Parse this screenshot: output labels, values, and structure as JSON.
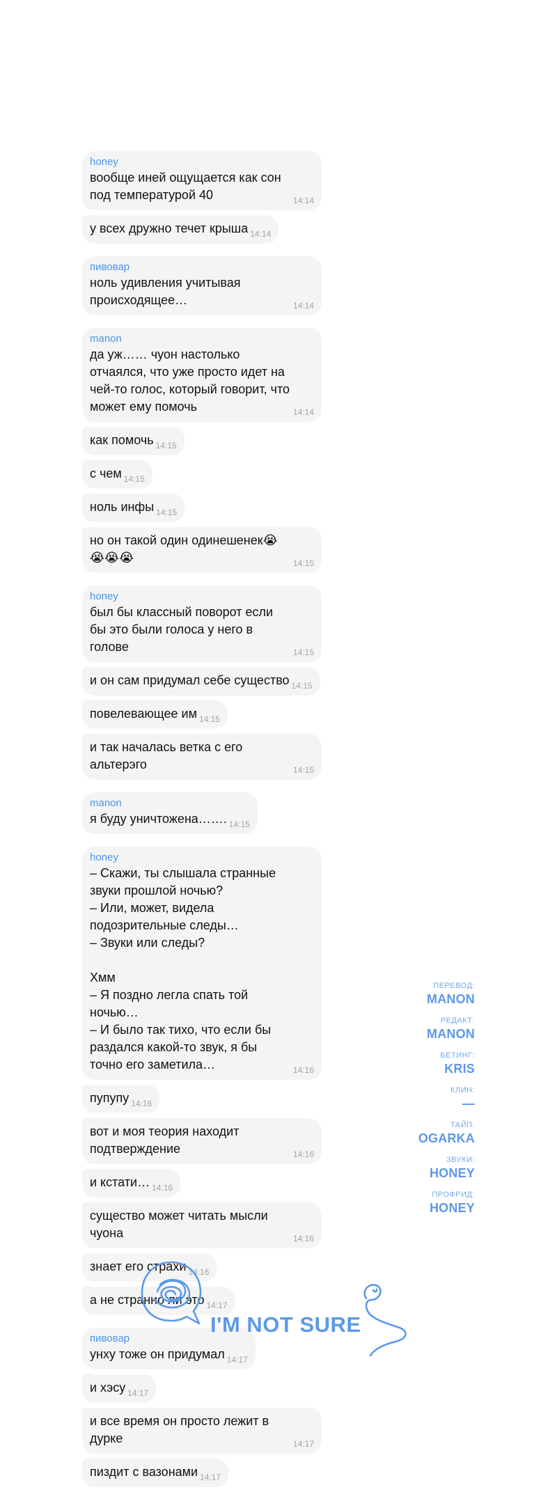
{
  "messages": [
    {
      "sender": "honey",
      "text": "вообще иней ощущается как сон под температурой 40",
      "time": "14:14"
    },
    {
      "text": "у всех дружно течет крыша",
      "time": "14:14"
    },
    {
      "sender": "пивовар",
      "text": "ноль удивления учитывая происходящее…",
      "time": "14:14"
    },
    {
      "sender": "manon",
      "text": "да уж…… чуон настолько отчаялся, что уже просто идет на чей-то голос, который говорит, что может ему помочь",
      "time": "14:14"
    },
    {
      "text": "как помочь",
      "time": "14:15"
    },
    {
      "text": "с чем",
      "time": "14:15"
    },
    {
      "text": "ноль инфы",
      "time": "14:15"
    },
    {
      "text": "но он такой один одинешенек😭😭😭😭",
      "time": "14:15"
    },
    {
      "sender": "honey",
      "text": "был бы классный поворот если бы это были голоса у него в голове",
      "time": "14:15"
    },
    {
      "text": "и он сам придумал себе существо",
      "time": "14:15"
    },
    {
      "text": "повелевающее им",
      "time": "14:15"
    },
    {
      "text": "и так началась ветка с его альтерэго",
      "time": "14:15"
    },
    {
      "sender": "manon",
      "text": "я буду уничтожена…….",
      "time": "14:15"
    },
    {
      "sender": "honey",
      "text": "– Скажи, ты слышала странные звуки прошлой ночью?\n– Или, может, видела подозрительные следы…\n– Звуки или следы?\n\nХмм\n– Я поздно легла спать той ночью…\n– И было так тихо, что если бы раздался какой-то звук, я бы точно его заметила…",
      "time": "14:16"
    },
    {
      "text": "пупупу",
      "time": "14:16"
    },
    {
      "text": "вот и моя теория находит подтверждение",
      "time": "14:16"
    },
    {
      "text": "и кстати…",
      "time": "14:16"
    },
    {
      "text": "существо может читать мысли чуона",
      "time": "14:16"
    },
    {
      "text": "знает его страхи",
      "time": "14:16"
    },
    {
      "text": "а не странно ли это",
      "time": "14:17"
    },
    {
      "sender": "пивовар",
      "text": "унху тоже он придумал",
      "time": "14:17"
    },
    {
      "text": "и хэсу",
      "time": "14:17"
    },
    {
      "text": "и все время он просто лежит в дурке",
      "time": "14:17"
    },
    {
      "text": "пиздит с вазонами",
      "time": "14:17"
    }
  ],
  "credits": [
    {
      "label": "ПЕРЕВОД:",
      "name": "MANON"
    },
    {
      "label": "РЕДАКТ:",
      "name": "MANON"
    },
    {
      "label": "БЕТИНГ:",
      "name": "KRIS"
    },
    {
      "label": "КЛИН:",
      "name": "—"
    },
    {
      "label": "ТАЙП:",
      "name": "OGARKA"
    },
    {
      "label": "ЗВУКИ:",
      "name": "HONEY"
    },
    {
      "label": "ПРОФРИД:",
      "name": "HONEY"
    }
  ],
  "logo": {
    "text": "I'M NOT SURE",
    "icon": "scribble-speech-bubble-icon"
  },
  "colors": {
    "accent": "#4a95e6",
    "bubble": "#f4f4f5",
    "time": "#a2a2a6"
  }
}
